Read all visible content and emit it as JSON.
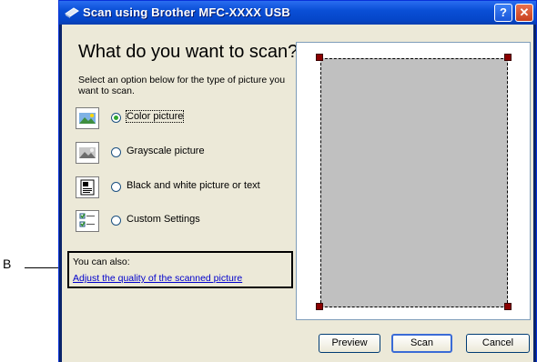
{
  "window": {
    "title": "Scan using Brother MFC-XXXX  USB",
    "help_button": "?",
    "close_button": "✕"
  },
  "content": {
    "heading": "What do you want to scan?",
    "instructions": "Select an option below for the type of picture you want to scan."
  },
  "options": [
    {
      "label": "Color picture",
      "selected": true,
      "icon": "color-picture-icon"
    },
    {
      "label": "Grayscale picture",
      "selected": false,
      "icon": "grayscale-picture-icon"
    },
    {
      "label": "Black and white picture or text",
      "selected": false,
      "icon": "bw-text-icon"
    },
    {
      "label": "Custom Settings",
      "selected": false,
      "icon": "custom-settings-icon"
    }
  ],
  "also": {
    "label": "You can also:",
    "link": "Adjust the quality of the scanned picture"
  },
  "buttons": {
    "preview": "Preview",
    "scan": "Scan",
    "cancel": "Cancel"
  },
  "callout": {
    "letter": "B"
  }
}
